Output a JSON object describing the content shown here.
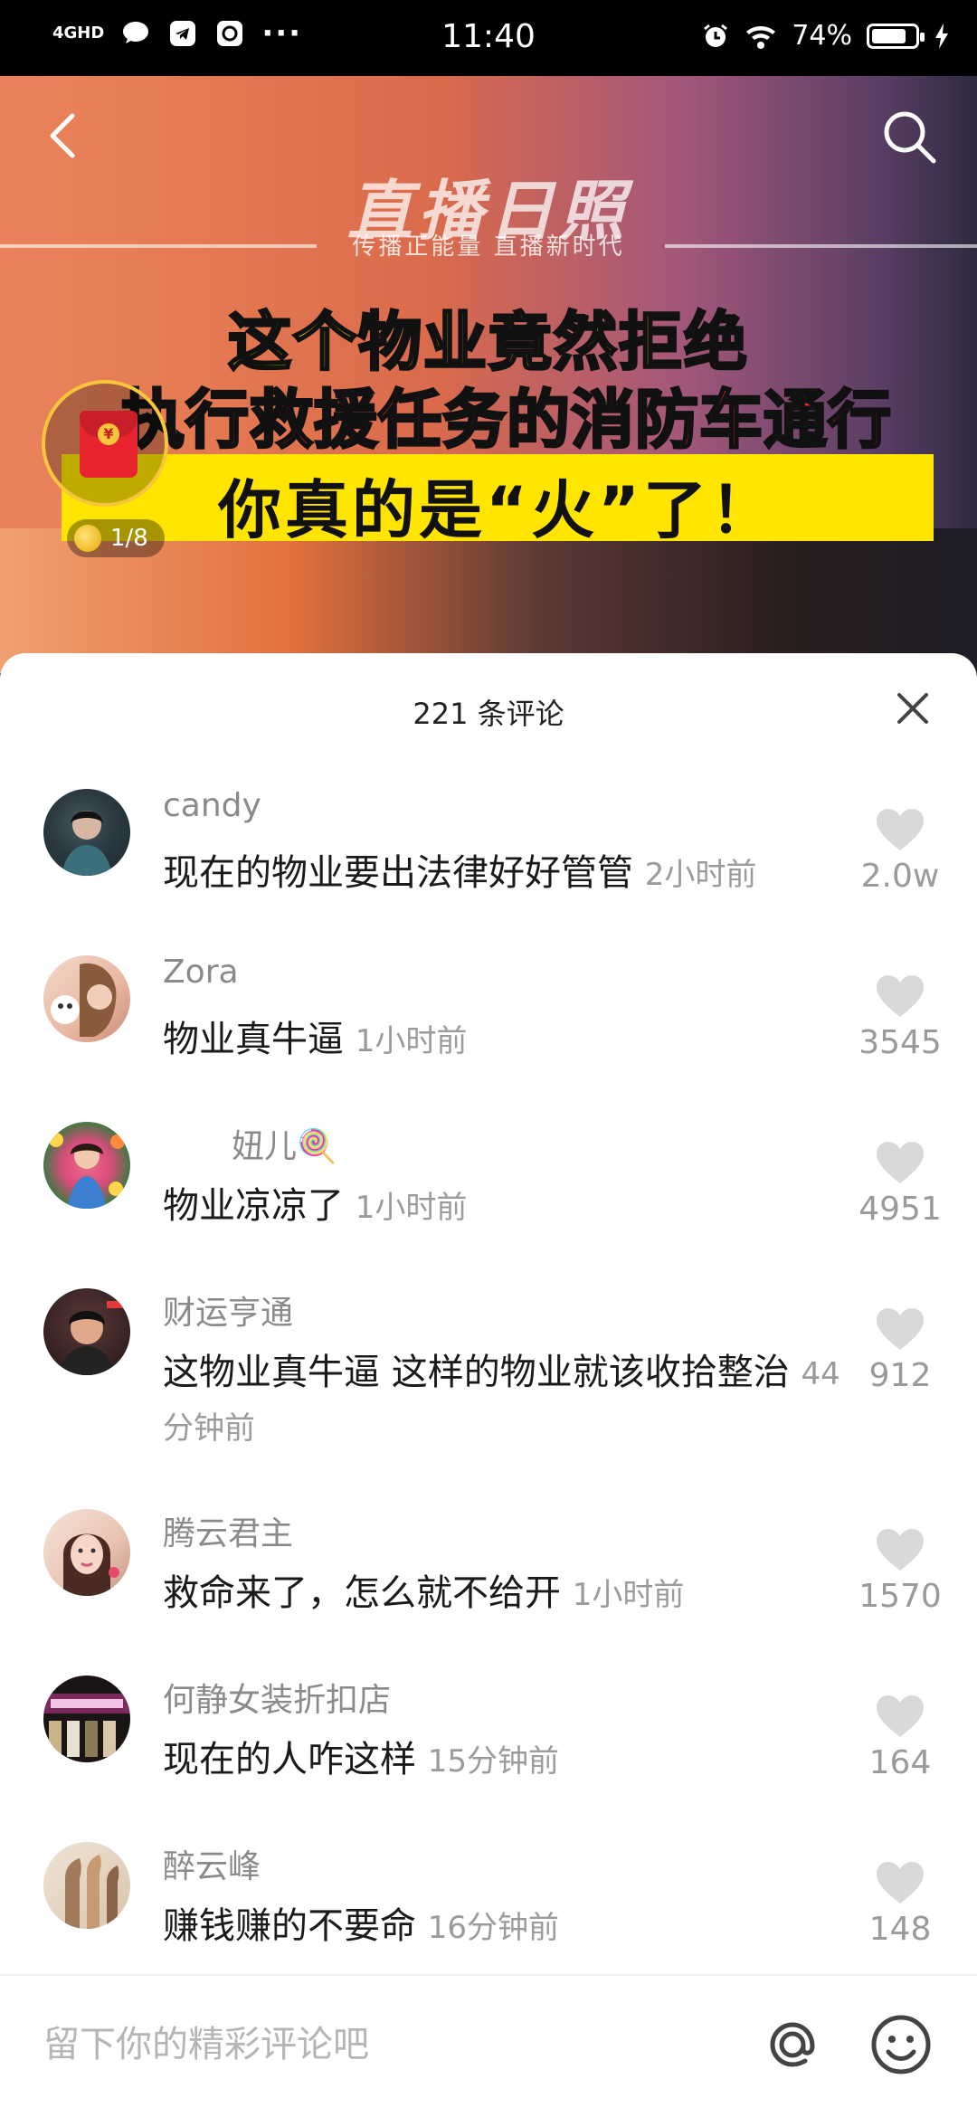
{
  "status_bar": {
    "network": "4GHD",
    "time": "11:40",
    "battery": "74%",
    "battery_level": 0.74
  },
  "video": {
    "logo_title": "直播日照",
    "logo_subtitle": "传播正能量 直播新时代",
    "headline_line1": "这个物业竟然拒绝",
    "headline_line2": "执行救援任务的消防车通行",
    "headline_line3": "你真的是“火”了！",
    "red_packet_progress": "1/8"
  },
  "comments_panel": {
    "title": "221 条评论",
    "comments": [
      {
        "user": "candy",
        "text": "现在的物业要出法律好好管管",
        "time": "2小时前",
        "likes": "2.0w"
      },
      {
        "user": "Zora",
        "text": "物业真牛逼",
        "time": "1小时前",
        "likes": "3545"
      },
      {
        "user": "妞儿🍭",
        "text": "物业凉凉了",
        "time": "1小时前",
        "likes": "4951"
      },
      {
        "user": "财运亨通",
        "text": "这物业真牛逼 这样的物业就该收拾整治",
        "time": "44分钟前",
        "likes": "912"
      },
      {
        "user": "腾云君主",
        "text": "救命来了，怎么就不给开",
        "time": "1小时前",
        "likes": "1570"
      },
      {
        "user": "何静女装折扣店",
        "text": "现在的人咋这样",
        "time": "15分钟前",
        "likes": "164"
      },
      {
        "user": "醉云峰",
        "text": "赚钱赚的不要命",
        "time": "16分钟前",
        "likes": "148"
      }
    ]
  },
  "input_bar": {
    "placeholder": "留下你的精彩评论吧"
  },
  "colors": {
    "headline_yellow": "#ffe100",
    "headline_red": "#ff2a2a",
    "muted_text": "#8a8a8a",
    "heart_gray": "#d9d9d9"
  }
}
